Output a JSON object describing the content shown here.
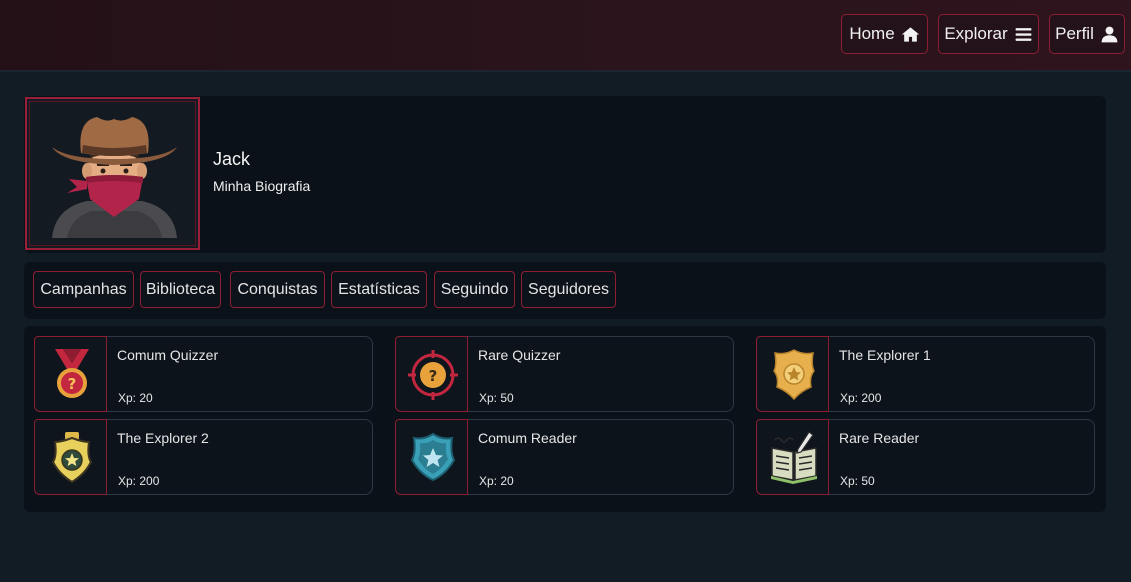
{
  "nav": {
    "home": "Home",
    "home_icon": "home-icon",
    "explorar": "Explorar",
    "explorar_icon": "bars-icon",
    "perfil": "Perfil",
    "perfil_icon": "user-icon"
  },
  "profile": {
    "name": "Jack",
    "bio": "Minha Biografia",
    "avatar_icon": "cowboy-bandit-avatar"
  },
  "tabs": [
    {
      "label": "Campanhas"
    },
    {
      "label": "Biblioteca"
    },
    {
      "label": "Conquistas"
    },
    {
      "label": "Estatísticas"
    },
    {
      "label": "Seguindo"
    },
    {
      "label": "Seguidores"
    }
  ],
  "achievements": [
    {
      "name": "Comum Quizzer",
      "xp": "Xp: 20",
      "icon": "medal-question-icon"
    },
    {
      "name": "Rare Quizzer",
      "xp": "Xp: 50",
      "icon": "target-question-icon"
    },
    {
      "name": "The Explorer 1",
      "xp": "Xp: 200",
      "icon": "gold-badge-icon"
    },
    {
      "name": "The Explorer 2",
      "xp": "Xp: 200",
      "icon": "sheriff-badge-icon"
    },
    {
      "name": "Comum Reader",
      "xp": "Xp: 20",
      "icon": "shield-star-icon"
    },
    {
      "name": "Rare Reader",
      "xp": "Xp: 50",
      "icon": "open-book-pen-icon"
    }
  ],
  "colors": {
    "accent": "#8c1e33",
    "background": "#121c25",
    "panel": "#0b1118",
    "topbar": "#2b141c"
  }
}
